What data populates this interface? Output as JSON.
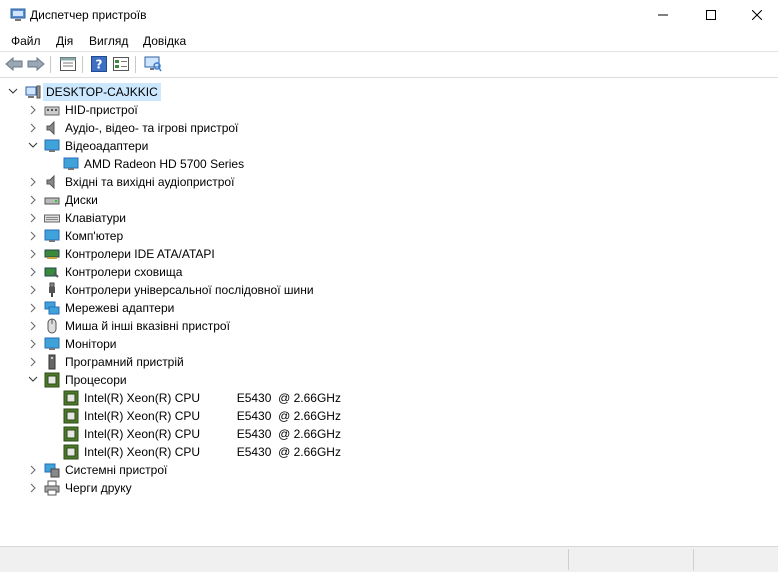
{
  "window": {
    "title": "Диспетчер пристроїв"
  },
  "menu": [
    "Файл",
    "Дія",
    "Вигляд",
    "Довідка"
  ],
  "toolbar": [
    "back-arrow-icon",
    "forward-arrow-icon",
    "properties-icon",
    "help-icon",
    "view-icon",
    "monitor-scan-icon"
  ],
  "tree": {
    "root": "DESKTOP-CAJKKIC",
    "categories": [
      {
        "label": "HID-пристрої",
        "icon": "hid-icon",
        "expanded": false
      },
      {
        "label": "Аудіо-, відео- та ігрові пристрої",
        "icon": "speaker-icon",
        "expanded": false
      },
      {
        "label": "Відеоадаптери",
        "icon": "display-adapter-icon",
        "expanded": true,
        "children": [
          {
            "label": "AMD Radeon HD 5700 Series",
            "icon": "display-adapter-icon"
          }
        ]
      },
      {
        "label": "Вхідні та вихідні аудіопристрої",
        "icon": "speaker-icon",
        "expanded": false
      },
      {
        "label": "Диски",
        "icon": "disk-icon",
        "expanded": false
      },
      {
        "label": "Клавіатури",
        "icon": "keyboard-icon",
        "expanded": false
      },
      {
        "label": "Комп'ютер",
        "icon": "computer-icon",
        "expanded": false
      },
      {
        "label": "Контролери IDE ATA/ATAPI",
        "icon": "ide-icon",
        "expanded": false
      },
      {
        "label": "Контролери сховища",
        "icon": "storage-icon",
        "expanded": false
      },
      {
        "label": "Контролери універсальної послідовної шини",
        "icon": "usb-icon",
        "expanded": false
      },
      {
        "label": "Мережеві адаптери",
        "icon": "network-icon",
        "expanded": false
      },
      {
        "label": "Миша й інші вказівні пристрої",
        "icon": "mouse-icon",
        "expanded": false
      },
      {
        "label": "Монітори",
        "icon": "monitor-icon",
        "expanded": false
      },
      {
        "label": "Програмний пристрій",
        "icon": "software-device-icon",
        "expanded": false
      },
      {
        "label": "Процесори",
        "icon": "cpu-icon",
        "expanded": true,
        "children": [
          {
            "label": "Intel(R) Xeon(R) CPU           E5430  @ 2.66GHz",
            "icon": "cpu-icon"
          },
          {
            "label": "Intel(R) Xeon(R) CPU           E5430  @ 2.66GHz",
            "icon": "cpu-icon"
          },
          {
            "label": "Intel(R) Xeon(R) CPU           E5430  @ 2.66GHz",
            "icon": "cpu-icon"
          },
          {
            "label": "Intel(R) Xeon(R) CPU           E5430  @ 2.66GHz",
            "icon": "cpu-icon"
          }
        ]
      },
      {
        "label": "Системні пристрої",
        "icon": "system-device-icon",
        "expanded": false
      },
      {
        "label": "Черги друку",
        "icon": "printer-icon",
        "expanded": false
      }
    ]
  },
  "colors": {
    "selection": "#cce8ff",
    "accent": "#2a6ebb",
    "cpu": "#4d7a2a"
  }
}
